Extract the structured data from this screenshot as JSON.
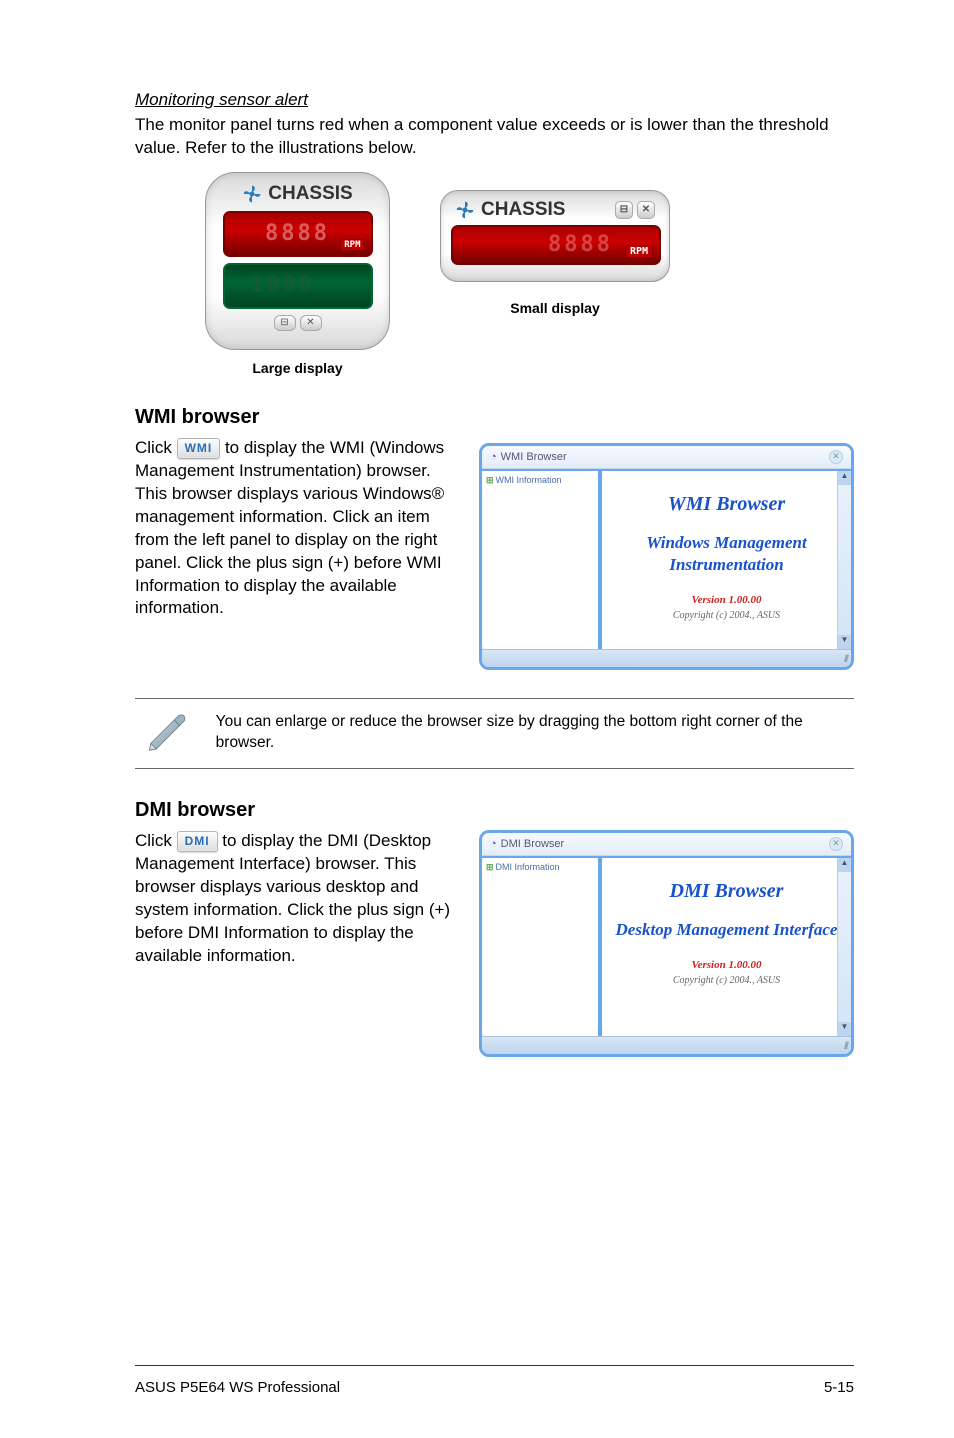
{
  "alert": {
    "subheading": "Monitoring sensor alert",
    "body": "The monitor panel turns red when a component value exceeds or is lower than the threshold value. Refer to the illustrations below.",
    "large_title": "CHASSIS",
    "large_red_unit": "RPM",
    "large_green_value": "1000",
    "small_title": "CHASSIS",
    "small_unit": "RPM",
    "caption_large": "Large display",
    "caption_small": "Small display"
  },
  "wmi": {
    "heading": "WMI browser",
    "text_before": "Click ",
    "btn": "WMI",
    "text_after": " to display the WMI (Windows Management Instrumentation) browser. This browser displays various Windows® management information. Click an item from the left panel to display on the right panel. Click the plus sign (+) before WMI Information to display the available information.",
    "window_title": "WMI Browser",
    "tree_root": "WMI Information",
    "content_h1": "WMI Browser",
    "content_h2": "Windows Management Instrumentation",
    "version": "Version 1.00.00",
    "copyright": "Copyright (c) 2004., ASUS"
  },
  "note": {
    "text": "You can enlarge or reduce the browser size by dragging the bottom right corner of the browser."
  },
  "dmi": {
    "heading": "DMI browser",
    "text_before": "Click ",
    "btn": "DMI",
    "text_after": " to display the DMI (Desktop Management Interface) browser. This browser displays various desktop and system information. Click the plus sign (+) before DMI Information to display the available information.",
    "window_title": "DMI Browser",
    "tree_root": "DMI Information",
    "content_h1": "DMI Browser",
    "content_h2": "Desktop Management Interface",
    "version": "Version 1.00.00",
    "copyright": "Copyright (c) 2004., ASUS"
  },
  "footer": {
    "left": "ASUS P5E64 WS Professional",
    "right": "5-15"
  }
}
